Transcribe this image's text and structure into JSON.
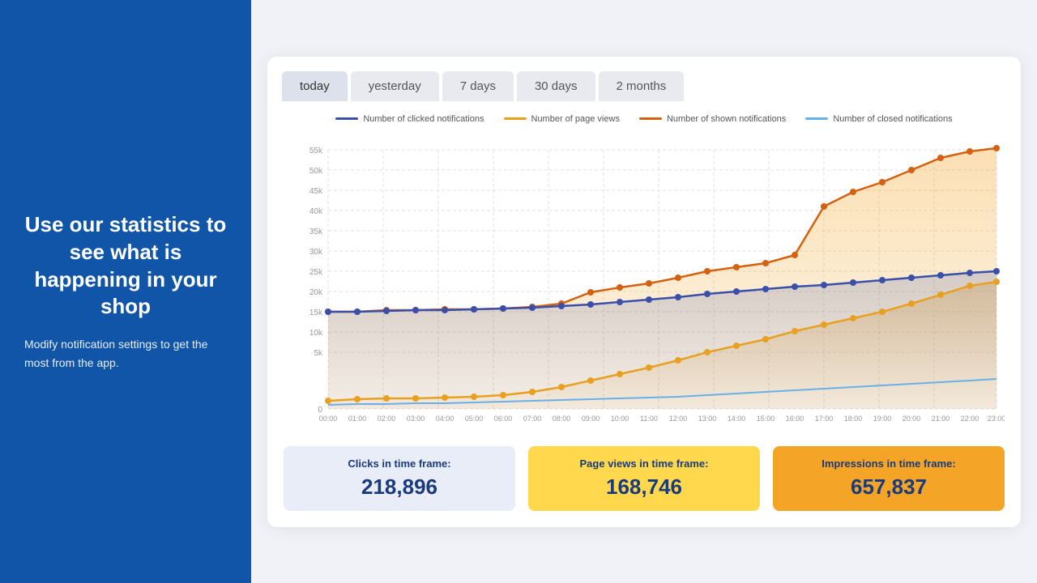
{
  "left": {
    "headline": "Use our statistics to see what is happening in your shop",
    "subtext": "Modify notification settings to get the most from the app."
  },
  "tabs": [
    {
      "label": "today",
      "active": true
    },
    {
      "label": "yesterday",
      "active": false
    },
    {
      "label": "7 days",
      "active": false
    },
    {
      "label": "30 days",
      "active": false
    },
    {
      "label": "2 months",
      "active": false
    }
  ],
  "legend": [
    {
      "label": "Number of clicked notifications",
      "color": "#3a4faa"
    },
    {
      "label": "Number of page views",
      "color": "#e8a020"
    },
    {
      "label": "Number of shown notifications",
      "color": "#d46010"
    },
    {
      "label": "Number of closed notifications",
      "color": "#6ab0e8"
    }
  ],
  "yAxis": [
    "55k",
    "50k",
    "45k",
    "40k",
    "35k",
    "30k",
    "25k",
    "20k",
    "15k",
    "10k",
    "5k",
    "0"
  ],
  "xAxis": [
    "00:00",
    "01:00",
    "02:00",
    "03:00",
    "04:00",
    "05:00",
    "06:00",
    "07:00",
    "08:00",
    "09:00",
    "10:00",
    "11:00",
    "12:00",
    "13:00",
    "14:00",
    "15:00",
    "16:00",
    "17:00",
    "18:00",
    "19:00",
    "20:00",
    "21:00",
    "22:00",
    "23:00"
  ],
  "stats": [
    {
      "label": "Clicks in time frame:",
      "value": "218,896",
      "style": "blue"
    },
    {
      "label": "Page views in time frame:",
      "value": "168,746",
      "style": "yellow"
    },
    {
      "label": "Impressions in time frame:",
      "value": "657,837",
      "style": "orange"
    }
  ]
}
